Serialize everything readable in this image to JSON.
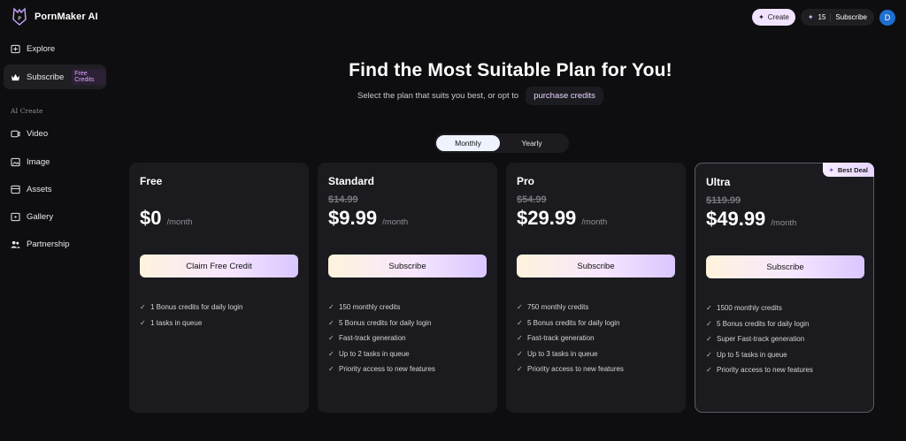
{
  "app": {
    "name": "PornMaker AI"
  },
  "sidebar": {
    "items": [
      {
        "label": "Explore",
        "icon": "compass-icon"
      },
      {
        "label": "Subscribe",
        "icon": "crown-icon",
        "badge": "Free Credits"
      }
    ],
    "section_label": "AI Create",
    "create_items": [
      {
        "label": "Video",
        "icon": "video-icon"
      },
      {
        "label": "Image",
        "icon": "image-icon"
      },
      {
        "label": "Assets",
        "icon": "assets-icon"
      },
      {
        "label": "Gallery",
        "icon": "gallery-icon"
      },
      {
        "label": "Partnership",
        "icon": "people-icon"
      }
    ]
  },
  "topbar": {
    "create_label": "Create",
    "credits": "15",
    "subscribe_label": "Subscribe",
    "avatar_initial": "D"
  },
  "header": {
    "title": "Find the Most Suitable Plan for You!",
    "subtitle": "Select the plan that suits you best, or opt to",
    "purchase_link": "purchase credits"
  },
  "billing_toggle": {
    "options": [
      "Monthly",
      "Yearly"
    ],
    "selected": "Monthly"
  },
  "plans": [
    {
      "name": "Free",
      "old_price": "",
      "price": "$0",
      "period": "/month",
      "cta": "Claim Free Credit",
      "features": [
        "1 Bonus credits for daily login",
        "1 tasks in queue"
      ]
    },
    {
      "name": "Standard",
      "old_price": "$14.99",
      "price": "$9.99",
      "period": "/month",
      "cta": "Subscribe",
      "features": [
        "150 monthly credits",
        "5 Bonus credits for daily login",
        "Fast-track generation",
        "Up to 2 tasks in queue",
        "Priority access to new features"
      ]
    },
    {
      "name": "Pro",
      "old_price": "$54.99",
      "price": "$29.99",
      "period": "/month",
      "cta": "Subscribe",
      "features": [
        "750 monthly credits",
        "5 Bonus credits for daily login",
        "Fast-track generation",
        "Up to 3 tasks in queue",
        "Priority access to new features"
      ]
    },
    {
      "name": "Ultra",
      "old_price": "$119.99",
      "price": "$49.99",
      "period": "/month",
      "cta": "Subscribe",
      "badge": "Best Deal",
      "features": [
        "1500 monthly credits",
        "5 Bonus credits for daily login",
        "Super Fast-track generation",
        "Up to 5 tasks in queue",
        "Priority access to new features"
      ]
    }
  ],
  "colors": {
    "background": "#0e0e10",
    "card": "#1b1b1f",
    "accent": "#e8d3ff",
    "avatar": "#1f6fd1"
  }
}
